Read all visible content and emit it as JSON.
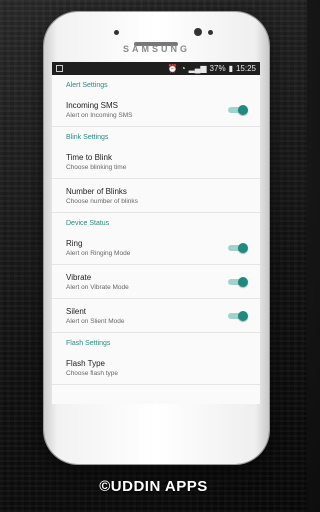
{
  "phone": {
    "brand": "SAMSUNG"
  },
  "status_bar": {
    "battery": "37%",
    "time": "15:25",
    "icons": [
      "alarm-icon",
      "wifi-icon",
      "signal-icon",
      "battery-icon"
    ]
  },
  "sections": [
    {
      "title": "Alert Settings",
      "items": [
        {
          "title": "Incoming SMS",
          "subtitle": "Alert on Incoming SMS",
          "toggle": true
        }
      ]
    },
    {
      "title": "Blink Settings",
      "items": [
        {
          "title": "Time to Blink",
          "subtitle": "Choose blinking time"
        },
        {
          "title": "Number of Blinks",
          "subtitle": "Choose number of blinks"
        }
      ]
    },
    {
      "title": "Device Status",
      "items": [
        {
          "title": "Ring",
          "subtitle": "Alert on Ringing Mode",
          "toggle": true
        },
        {
          "title": "Vibrate",
          "subtitle": "Alert on Vibrate Mode",
          "toggle": true
        },
        {
          "title": "Silent",
          "subtitle": "Alert on Slient Mode",
          "toggle": true
        }
      ]
    },
    {
      "title": "Flash Settings",
      "items": [
        {
          "title": "Flash Type",
          "subtitle": "Choose flash type"
        }
      ]
    }
  ],
  "credit": "©UDDIN APPS",
  "colors": {
    "accent": "#1f8a7f",
    "section_title": "#2a8a82",
    "toggle_track": "#9fd3cd"
  }
}
